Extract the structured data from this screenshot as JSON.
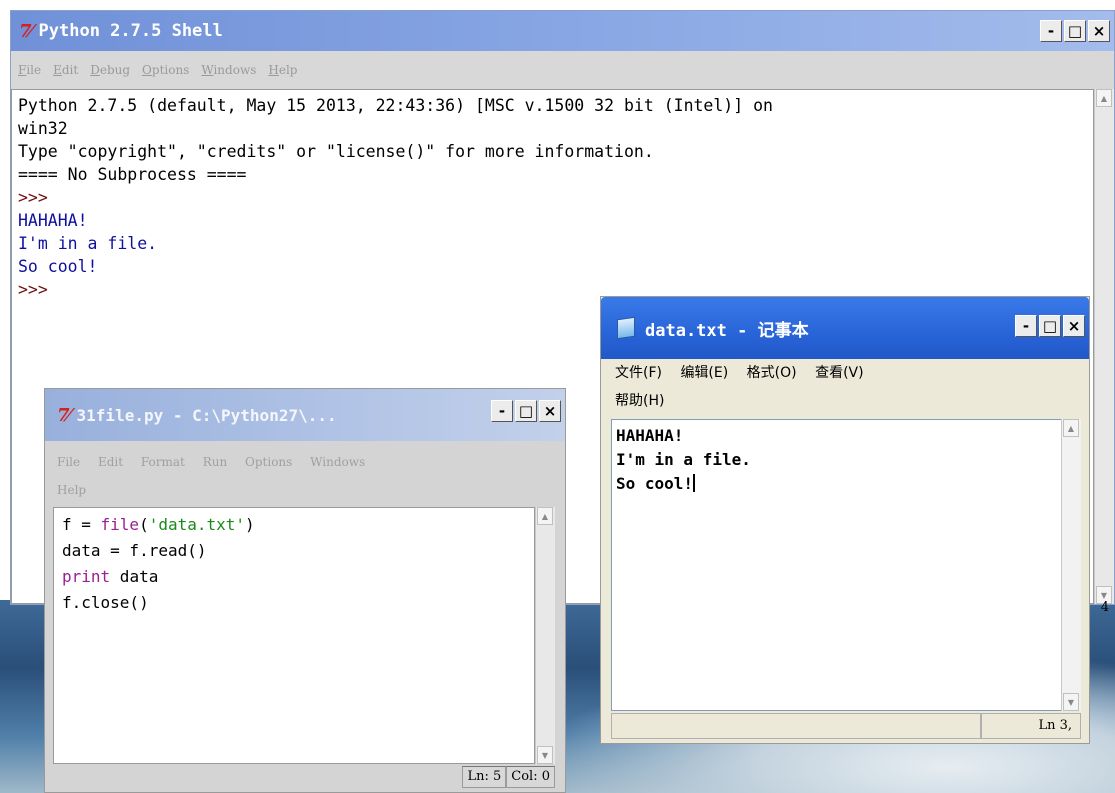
{
  "shell": {
    "title": "Python 2.7.5 Shell",
    "menu": [
      {
        "label": "File",
        "u": "F",
        "rest": "ile"
      },
      {
        "label": "Edit",
        "u": "E",
        "rest": "dit"
      },
      {
        "label": "Debug",
        "u": "D",
        "rest": "ebug"
      },
      {
        "label": "Options",
        "u": "O",
        "rest": "ptions"
      },
      {
        "label": "Windows",
        "u": "W",
        "rest": "indows"
      },
      {
        "label": "Help",
        "u": "H",
        "rest": "elp"
      }
    ],
    "lines": [
      {
        "text": "Python 2.7.5 (default, May 15 2013, 22:43:36) [MSC v.1500 32 bit (Intel)] on",
        "kind": "normal"
      },
      {
        "text": "win32",
        "kind": "normal"
      },
      {
        "text": "Type \"copyright\", \"credits\" or \"license()\" for more information.",
        "kind": "normal"
      },
      {
        "text": "==== No Subprocess ====",
        "kind": "normal"
      },
      {
        "text": ">>> ",
        "kind": "prompt"
      },
      {
        "text": "HAHAHA!",
        "kind": "out"
      },
      {
        "text": "I'm in a file.",
        "kind": "out"
      },
      {
        "text": "So cool!",
        "kind": "out"
      },
      {
        "text": ">>> ",
        "kind": "prompt"
      }
    ],
    "side_number": "4",
    "buttons": {
      "minimize": "-",
      "maximize": "□",
      "close": "×"
    }
  },
  "editor": {
    "title": "31file.py - C:\\Python27\\...",
    "menu_line1": [
      "File",
      "Edit",
      "Format",
      "Run",
      "Options",
      "Windows"
    ],
    "menu_line2": [
      "Help"
    ],
    "code": {
      "l1_a": "f = ",
      "l1_b": "file",
      "l1_c": "(",
      "l1_d": "'data.txt'",
      "l1_e": ")",
      "l2": "data = f.read()",
      "l3_a": "print",
      "l3_b": " data",
      "l4": "f.close()"
    },
    "status_ln": "Ln: 5",
    "status_col": "Col: 0"
  },
  "notepad": {
    "title": "data.txt - 记事本",
    "menu_line1": [
      "文件(F)",
      "编辑(E)",
      "格式(O)",
      "查看(V)"
    ],
    "menu_line2": [
      "帮助(H)"
    ],
    "lines": [
      "HAHAHA!",
      "I'm in a file.",
      "So cool!"
    ],
    "status": "Ln 3,"
  }
}
